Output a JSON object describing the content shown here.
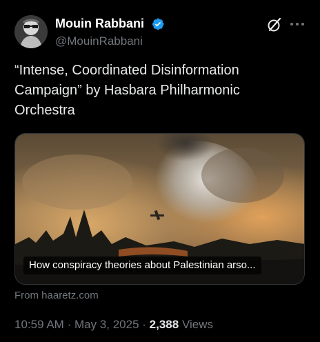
{
  "author": {
    "display_name": "Mouin Rabbani",
    "handle": "@MouinRabbani",
    "verified": true,
    "verified_color": "#1d9bf0"
  },
  "tweet": {
    "text_lines": [
      "“Intense, Coordinated Disinformation",
      "Campaign” by Hasbara Philharmonic",
      "Orchestra"
    ]
  },
  "link_card": {
    "headline": "How conspiracy theories about Palestinian arso...",
    "source": "From haaretz.com",
    "image_subject": "wildfire-smoke-with-firefighting-aircraft"
  },
  "meta": {
    "time": "10:59 AM",
    "separator": "·",
    "date": "May 3, 2025",
    "views_count": "2,388",
    "views_label": "Views"
  },
  "icons": {
    "header_actions": [
      "grok-icon",
      "more-icon"
    ],
    "badge": "verified-badge-icon"
  },
  "colors": {
    "background": "#000000",
    "primary_text": "#e7e9ea",
    "secondary_text": "#71767b"
  }
}
